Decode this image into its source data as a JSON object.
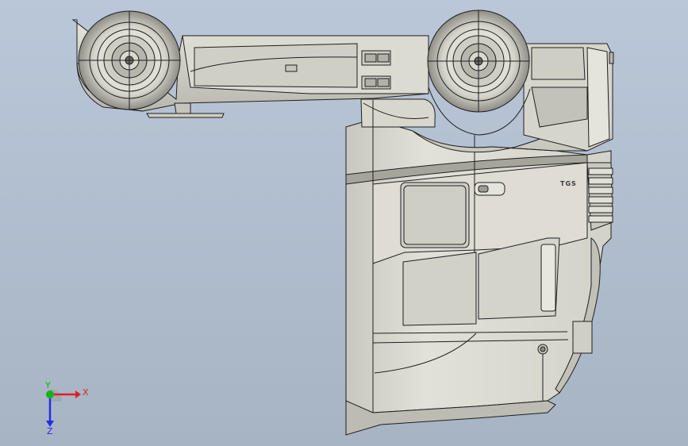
{
  "viewport": {
    "background_top": "#bac7d8",
    "background_bottom": "#a7b4c4",
    "model_fill": "#d9d8cf",
    "model_shade": "#a6a59c",
    "edge_color": "#1f1f1f"
  },
  "model": {
    "badge_text": "TGS",
    "icon": "truck-cab-model"
  },
  "triad": {
    "x_label": "X",
    "y_label": "Y",
    "z_label": "Z",
    "x_color": "#e02020",
    "y_color": "#17b017",
    "z_color": "#2030e0"
  }
}
